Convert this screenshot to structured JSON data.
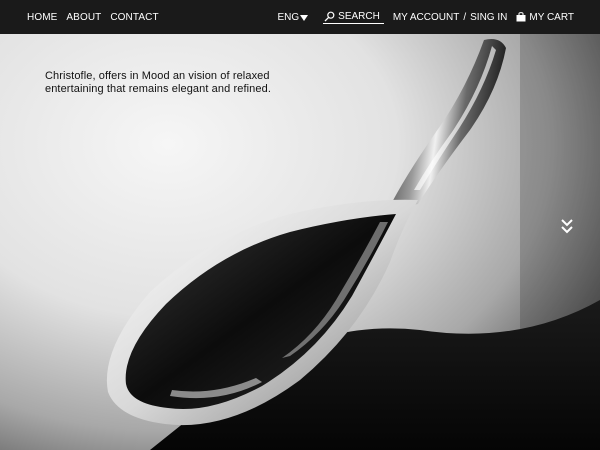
{
  "nav": {
    "home": "HOME",
    "about": "ABOUT",
    "contact": "CONTACT"
  },
  "header": {
    "language": "ENG",
    "search_label": "SEARCH",
    "account_label": "MY ACCOUNT",
    "separator": "/",
    "signin_label": "SING IN",
    "cart_label": "MY CART"
  },
  "hero": {
    "tagline_line1": "Christofle, offers in Mood an vision of relaxed",
    "tagline_line2": "entertaining that remains elegant and refined."
  },
  "icons": {
    "language_dropdown": "triangle-down-icon",
    "search": "magnifier-icon",
    "cart": "shopping-bag-icon",
    "scroll": "double-chevron-down-icon"
  },
  "colors": {
    "topbar": "#1a1a1a",
    "text_light": "#ffffff",
    "text_dark": "#111111",
    "background_light": "#f2f2f2",
    "background_dark": "#0d0d0d"
  }
}
